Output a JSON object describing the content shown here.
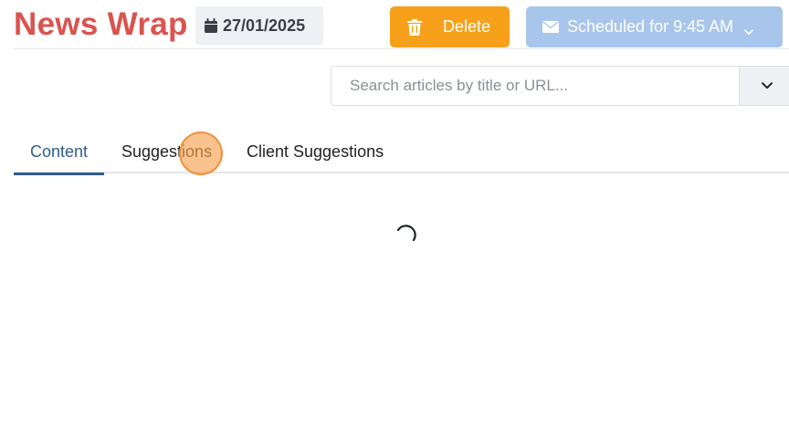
{
  "header": {
    "title": "News Wrap",
    "date": "27/01/2025",
    "delete_label": "Delete",
    "schedule_label": "Scheduled for 9:45 AM"
  },
  "search": {
    "placeholder": "Search articles by title or URL...",
    "value": ""
  },
  "tabs": [
    {
      "label": "Content",
      "active": true
    },
    {
      "label": "Suggestions",
      "active": false
    },
    {
      "label": "Client Suggestions",
      "active": false
    }
  ],
  "colors": {
    "brand": "#d9534f",
    "delete": "#f7a11b",
    "schedule": "#a8c6ec",
    "tab_active": "#2f5d8a"
  },
  "icons": {
    "date": "calendar-icon",
    "delete": "trash-icon",
    "schedule": "envelope-icon",
    "schedule_dropdown": "chevron-down-icon",
    "search_dropdown": "chevron-down-icon",
    "loading": "spinner-icon"
  },
  "state": {
    "loading": true
  }
}
